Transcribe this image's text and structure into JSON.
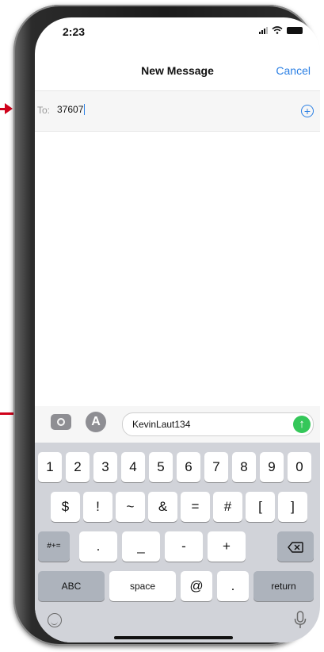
{
  "status_bar": {
    "time": "2:23"
  },
  "nav": {
    "title": "New Message",
    "cancel": "Cancel"
  },
  "recipient": {
    "label": "To:",
    "value": "37607",
    "add_icon": "plus-circle-icon"
  },
  "compose": {
    "text": "KevinLaut134",
    "send_icon": "arrow-up-icon",
    "camera_icon": "camera-icon",
    "appstore_icon": "appstore-icon"
  },
  "keyboard": {
    "row1": [
      "1",
      "2",
      "3",
      "4",
      "5",
      "6",
      "7",
      "8",
      "9",
      "0"
    ],
    "row2": [
      "$",
      "!",
      "~",
      "&",
      "=",
      "#",
      "[",
      "]"
    ],
    "row3": [
      "#+=",
      ".",
      "_",
      "-",
      "+"
    ],
    "row4": [
      "ABC",
      "space",
      "@",
      ".",
      "return"
    ]
  },
  "colors": {
    "accent": "#2a7fe4",
    "send": "#34c759",
    "arrow": "#d0021b"
  }
}
